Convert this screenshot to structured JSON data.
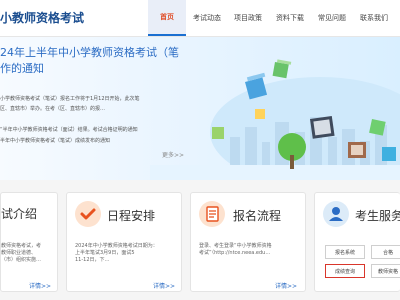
{
  "header": {
    "site_title": "小教师资格考试"
  },
  "nav": [
    "首页",
    "考试动态",
    "项目政策",
    "资料下载",
    "常见问题",
    "联系我们"
  ],
  "banner": {
    "title_line1": "24年上半年中小学教师资格考试（笔",
    "title_line2": "作的通知"
  },
  "news": [
    "小学教师资格考试（笔试）报名工作将于1月12日开始，此次笔",
    "区、直辖市）举办。在考（区、直辖市）的报…",
    "“半年中小学教师资格考试（面试）结果。考试合格证明的通知",
    "半年中小学教师资格考试（笔试）成绩发布的通知"
  ],
  "news_more": "更多>>",
  "cards": [
    {
      "title": "试介绍",
      "text": [
        "教师资格考试，考",
        "教师职业道德、",
        "（市）组织实施…"
      ],
      "more": "详情>>"
    },
    {
      "title": "日程安排",
      "text": [
        "2024年中小学教师资格考试日期为：",
        "上半年笔试3月9日，面试5",
        "11-12日，下…"
      ],
      "more": "详情>>"
    },
    {
      "title": "报名流程",
      "text": [
        "登录、考生登录“中小学教师资格",
        "考试”（http://ntce.neea.edu…"
      ],
      "more": "详情>>"
    },
    {
      "title": "考生服务",
      "buttons": [
        "报名系统",
        "合格",
        "成绩查询",
        "教师资格"
      ]
    }
  ]
}
